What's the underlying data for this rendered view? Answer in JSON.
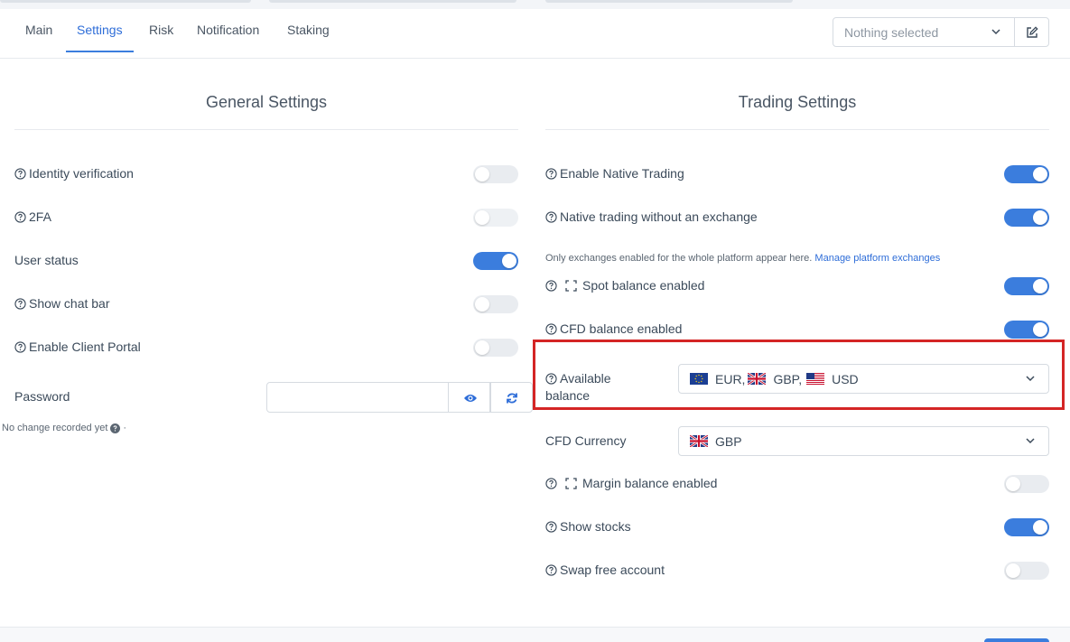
{
  "tabs": [
    {
      "label": "Main"
    },
    {
      "label": "Settings"
    },
    {
      "label": "Risk"
    },
    {
      "label": "Notification"
    },
    {
      "label": "Staking"
    }
  ],
  "selector": {
    "placeholder": "Nothing selected"
  },
  "general": {
    "title": "General Settings",
    "identity_verification": "Identity verification",
    "twofa": "2FA",
    "user_status": "User status",
    "show_chat_bar": "Show chat bar",
    "client_portal": "Enable Client Portal",
    "password_label": "Password",
    "no_change": "No change recorded yet",
    "no_change_suffix": "·"
  },
  "trading": {
    "title": "Trading Settings",
    "native_trading": "Enable Native Trading",
    "native_no_exchange": "Native trading without an exchange",
    "note": "Only exchanges enabled for the whole platform appear here.",
    "note_link": "Manage platform exchanges",
    "spot_balance": "Spot balance enabled",
    "cfd_balance": "CFD balance enabled",
    "available_balance_1": "Available",
    "available_balance_2": "balance",
    "available_values": {
      "eur": "EUR,",
      "gbp": "GBP,",
      "usd": "USD"
    },
    "cfd_currency_label": "CFD Currency",
    "cfd_currency_value": "GBP",
    "margin_balance": "Margin balance enabled",
    "show_stocks": "Show stocks",
    "swap_free": "Swap free account"
  },
  "colors": {
    "accent": "#3b7ddd",
    "highlight": "#d42525"
  }
}
